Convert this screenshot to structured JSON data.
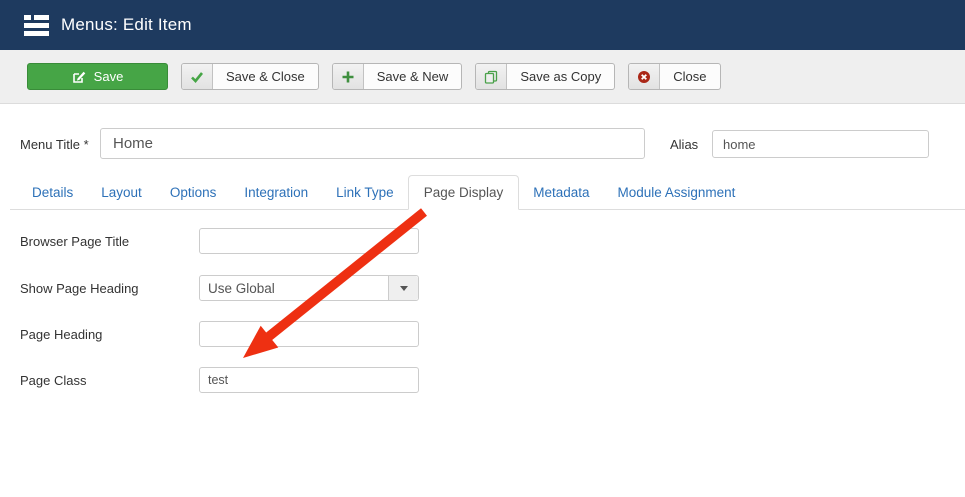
{
  "colors": {
    "header_bg": "#1e3a5f",
    "accent_green": "#46a546",
    "link_blue": "#2d71b8",
    "arrow_red": "#ee3012"
  },
  "header": {
    "title": "Menus: Edit Item",
    "icon": "menus-list-icon"
  },
  "toolbar": {
    "buttons": [
      {
        "label": "Save",
        "icon": "edit-icon"
      },
      {
        "label": "Save & Close",
        "icon": "check-icon"
      },
      {
        "label": "Save & New",
        "icon": "plus-icon"
      },
      {
        "label": "Save as Copy",
        "icon": "copy-icon"
      },
      {
        "label": "Close",
        "icon": "close-circle-icon"
      }
    ]
  },
  "title_row": {
    "menu_title_label": "Menu Title *",
    "menu_title_value": "Home",
    "alias_label": "Alias",
    "alias_value": "home"
  },
  "tabs": {
    "active": "Page Display",
    "items": [
      {
        "label": "Details"
      },
      {
        "label": "Layout"
      },
      {
        "label": "Options"
      },
      {
        "label": "Integration"
      },
      {
        "label": "Link Type"
      },
      {
        "label": "Page Display"
      },
      {
        "label": "Metadata"
      },
      {
        "label": "Module Assignment"
      }
    ]
  },
  "form": {
    "fields": [
      {
        "label": "Browser Page Title",
        "type": "text",
        "value": ""
      },
      {
        "label": "Show Page Heading",
        "type": "select",
        "value": "Use Global"
      },
      {
        "label": "Page Heading",
        "type": "text",
        "value": ""
      },
      {
        "label": "Page Class",
        "type": "text",
        "value": "test"
      }
    ]
  },
  "annotation": {
    "type": "arrow",
    "color": "#ee3012",
    "points_to": "Page Class field"
  }
}
